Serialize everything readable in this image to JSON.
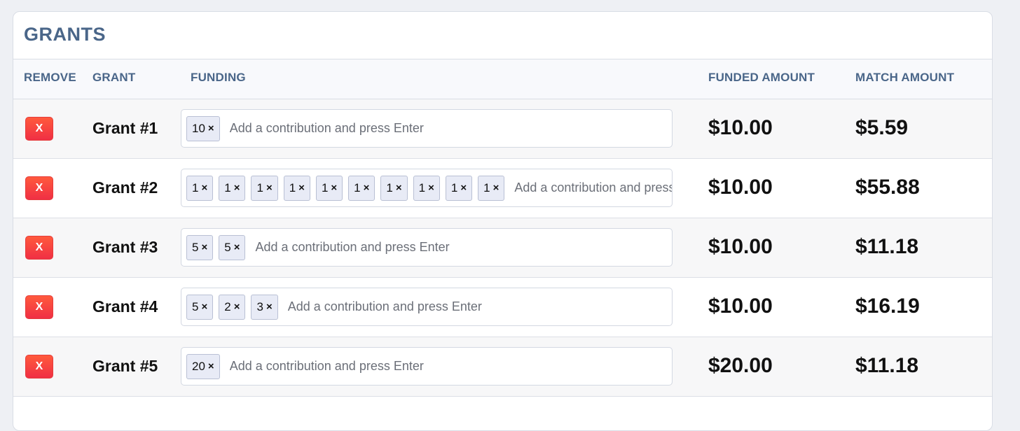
{
  "title": "GRANTS",
  "columns": {
    "remove": "REMOVE",
    "grant": "GRANT",
    "funding": "FUNDING",
    "funded_amount": "FUNDED AMOUNT",
    "match_amount": "MATCH AMOUNT"
  },
  "remove_label": "X",
  "tag_close_glyph": "×",
  "input_placeholder": "Add a contribution and press Enter",
  "rows": [
    {
      "name": "Grant #1",
      "contributions": [
        "10"
      ],
      "funded": "$10.00",
      "match": "$5.59"
    },
    {
      "name": "Grant #2",
      "contributions": [
        "1",
        "1",
        "1",
        "1",
        "1",
        "1",
        "1",
        "1",
        "1",
        "1"
      ],
      "funded": "$10.00",
      "match": "$55.88"
    },
    {
      "name": "Grant #3",
      "contributions": [
        "5",
        "5"
      ],
      "funded": "$10.00",
      "match": "$11.18"
    },
    {
      "name": "Grant #4",
      "contributions": [
        "5",
        "2",
        "3"
      ],
      "funded": "$10.00",
      "match": "$16.19"
    },
    {
      "name": "Grant #5",
      "contributions": [
        "20"
      ],
      "funded": "$20.00",
      "match": "$11.18"
    }
  ]
}
